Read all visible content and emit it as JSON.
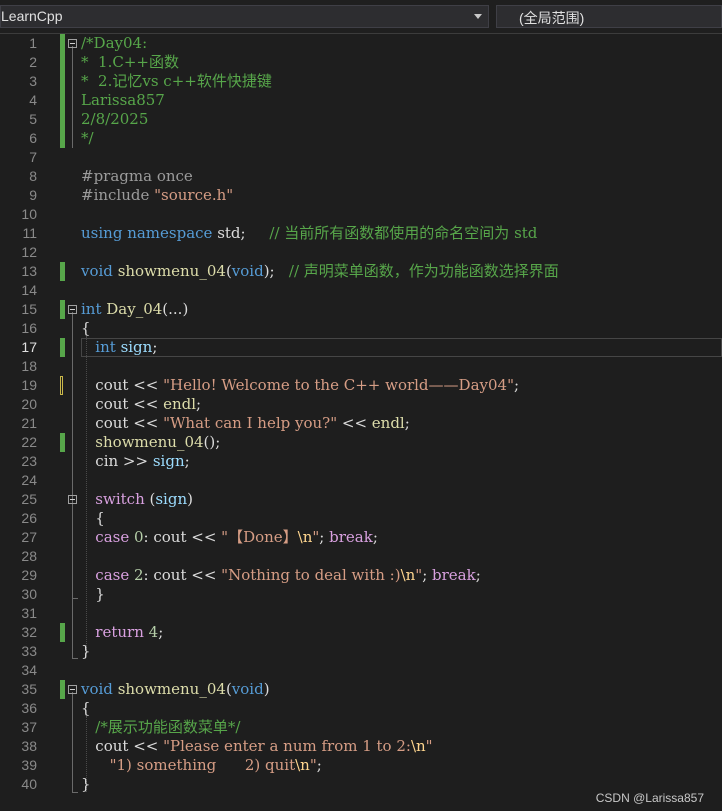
{
  "toolbar": {
    "project_dropdown": "LearnCpp",
    "scope_dropdown": "(全局范围)"
  },
  "editor": {
    "current_line": 17,
    "lines": [
      {
        "n": 1,
        "tokens": [
          {
            "t": "/*Day04:",
            "c": "com"
          }
        ]
      },
      {
        "n": 2,
        "tokens": [
          {
            "t": "*  1.C++函数",
            "c": "com"
          }
        ]
      },
      {
        "n": 3,
        "tokens": [
          {
            "t": "*  2.记忆vs c++软件快捷键",
            "c": "com"
          }
        ]
      },
      {
        "n": 4,
        "tokens": [
          {
            "t": "Larissa857",
            "c": "com"
          }
        ]
      },
      {
        "n": 5,
        "tokens": [
          {
            "t": "2/8/2025",
            "c": "com"
          }
        ]
      },
      {
        "n": 6,
        "tokens": [
          {
            "t": "*/",
            "c": "com"
          }
        ]
      },
      {
        "n": 7,
        "tokens": []
      },
      {
        "n": 8,
        "tokens": [
          {
            "t": "#pragma once",
            "c": "pp"
          }
        ]
      },
      {
        "n": 9,
        "tokens": [
          {
            "t": "#include ",
            "c": "pp"
          },
          {
            "t": "\"source.h\"",
            "c": "str"
          }
        ]
      },
      {
        "n": 10,
        "tokens": []
      },
      {
        "n": 11,
        "tokens": [
          {
            "t": "using ",
            "c": "kw"
          },
          {
            "t": "namespace ",
            "c": "kw"
          },
          {
            "t": "std;     ",
            "c": "txt"
          },
          {
            "t": "// 当前所有函数都使用的命名空间为 std",
            "c": "com"
          }
        ]
      },
      {
        "n": 12,
        "tokens": []
      },
      {
        "n": 13,
        "tokens": [
          {
            "t": "void ",
            "c": "kw"
          },
          {
            "t": "showmenu_04",
            "c": "fn"
          },
          {
            "t": "(",
            "c": "txt"
          },
          {
            "t": "void",
            "c": "kw"
          },
          {
            "t": ");   ",
            "c": "txt"
          },
          {
            "t": "// 声明菜单函数，作为功能函数选择界面",
            "c": "com"
          }
        ]
      },
      {
        "n": 14,
        "tokens": []
      },
      {
        "n": 15,
        "tokens": [
          {
            "t": "int ",
            "c": "kw"
          },
          {
            "t": "Day_04",
            "c": "fn"
          },
          {
            "t": "(...)",
            "c": "txt"
          }
        ]
      },
      {
        "n": 16,
        "tokens": [
          {
            "t": "{",
            "c": "txt"
          }
        ]
      },
      {
        "n": 17,
        "tokens": [
          {
            "t": "   int ",
            "c": "kw"
          },
          {
            "t": "sign",
            "c": "var"
          },
          {
            "t": ";",
            "c": "txt"
          }
        ]
      },
      {
        "n": 18,
        "tokens": []
      },
      {
        "n": 19,
        "tokens": [
          {
            "t": "   cout << ",
            "c": "txt"
          },
          {
            "t": "\"Hello! Welcome to the C++ world——Day04\"",
            "c": "str"
          },
          {
            "t": ";",
            "c": "txt"
          }
        ]
      },
      {
        "n": 20,
        "tokens": [
          {
            "t": "   cout << ",
            "c": "txt"
          },
          {
            "t": "endl",
            "c": "fn"
          },
          {
            "t": ";",
            "c": "txt"
          }
        ]
      },
      {
        "n": 21,
        "tokens": [
          {
            "t": "   cout << ",
            "c": "txt"
          },
          {
            "t": "\"What can I help you?\"",
            "c": "str"
          },
          {
            "t": " << ",
            "c": "txt"
          },
          {
            "t": "endl",
            "c": "fn"
          },
          {
            "t": ";",
            "c": "txt"
          }
        ]
      },
      {
        "n": 22,
        "tokens": [
          {
            "t": "   showmenu_04",
            "c": "fn"
          },
          {
            "t": "();",
            "c": "txt"
          }
        ]
      },
      {
        "n": 23,
        "tokens": [
          {
            "t": "   cin >> ",
            "c": "txt"
          },
          {
            "t": "sign",
            "c": "var"
          },
          {
            "t": ";",
            "c": "txt"
          }
        ]
      },
      {
        "n": 24,
        "tokens": []
      },
      {
        "n": 25,
        "tokens": [
          {
            "t": "   switch ",
            "c": "ctl"
          },
          {
            "t": "(",
            "c": "txt"
          },
          {
            "t": "sign",
            "c": "var"
          },
          {
            "t": ")",
            "c": "txt"
          }
        ]
      },
      {
        "n": 26,
        "tokens": [
          {
            "t": "   {",
            "c": "txt"
          }
        ]
      },
      {
        "n": 27,
        "tokens": [
          {
            "t": "   case ",
            "c": "ctl"
          },
          {
            "t": "0",
            "c": "num"
          },
          {
            "t": ": cout << ",
            "c": "txt"
          },
          {
            "t": "\"【Done】",
            "c": "str"
          },
          {
            "t": "\\n",
            "c": "esc"
          },
          {
            "t": "\"",
            "c": "str"
          },
          {
            "t": "; ",
            "c": "txt"
          },
          {
            "t": "break",
            "c": "ctl"
          },
          {
            "t": ";",
            "c": "txt"
          }
        ]
      },
      {
        "n": 28,
        "tokens": []
      },
      {
        "n": 29,
        "tokens": [
          {
            "t": "   case ",
            "c": "ctl"
          },
          {
            "t": "2",
            "c": "num"
          },
          {
            "t": ": cout << ",
            "c": "txt"
          },
          {
            "t": "\"Nothing to deal with :)",
            "c": "str"
          },
          {
            "t": "\\n",
            "c": "esc"
          },
          {
            "t": "\"",
            "c": "str"
          },
          {
            "t": "; ",
            "c": "txt"
          },
          {
            "t": "break",
            "c": "ctl"
          },
          {
            "t": ";",
            "c": "txt"
          }
        ]
      },
      {
        "n": 30,
        "tokens": [
          {
            "t": "   }",
            "c": "txt"
          }
        ]
      },
      {
        "n": 31,
        "tokens": []
      },
      {
        "n": 32,
        "tokens": [
          {
            "t": "   return ",
            "c": "ctl"
          },
          {
            "t": "4",
            "c": "num"
          },
          {
            "t": ";",
            "c": "txt"
          }
        ]
      },
      {
        "n": 33,
        "tokens": [
          {
            "t": "}",
            "c": "txt"
          }
        ]
      },
      {
        "n": 34,
        "tokens": []
      },
      {
        "n": 35,
        "tokens": [
          {
            "t": "void ",
            "c": "kw"
          },
          {
            "t": "showmenu_04",
            "c": "fn"
          },
          {
            "t": "(",
            "c": "txt"
          },
          {
            "t": "void",
            "c": "kw"
          },
          {
            "t": ")",
            "c": "txt"
          }
        ]
      },
      {
        "n": 36,
        "tokens": [
          {
            "t": "{",
            "c": "txt"
          }
        ]
      },
      {
        "n": 37,
        "tokens": [
          {
            "t": "   /*展示功能函数菜单*/",
            "c": "com"
          }
        ]
      },
      {
        "n": 38,
        "tokens": [
          {
            "t": "   cout << ",
            "c": "txt"
          },
          {
            "t": "\"Please enter a num from 1 to 2:",
            "c": "str"
          },
          {
            "t": "\\n",
            "c": "esc"
          },
          {
            "t": "\"",
            "c": "str"
          }
        ]
      },
      {
        "n": 39,
        "tokens": [
          {
            "t": "      \"1) something      2) quit",
            "c": "str"
          },
          {
            "t": "\\n",
            "c": "esc"
          },
          {
            "t": "\"",
            "c": "str"
          },
          {
            "t": ";",
            "c": "txt"
          }
        ]
      },
      {
        "n": 40,
        "tokens": [
          {
            "t": "}",
            "c": "txt"
          }
        ]
      }
    ],
    "change_bars_green": [
      1,
      2,
      3,
      4,
      5,
      6,
      13,
      15,
      17,
      22,
      32,
      35
    ],
    "change_bars_yellow": [
      19
    ],
    "fold_markers": [
      1,
      15,
      25,
      35
    ]
  },
  "watermark": "CSDN @Larissa857"
}
